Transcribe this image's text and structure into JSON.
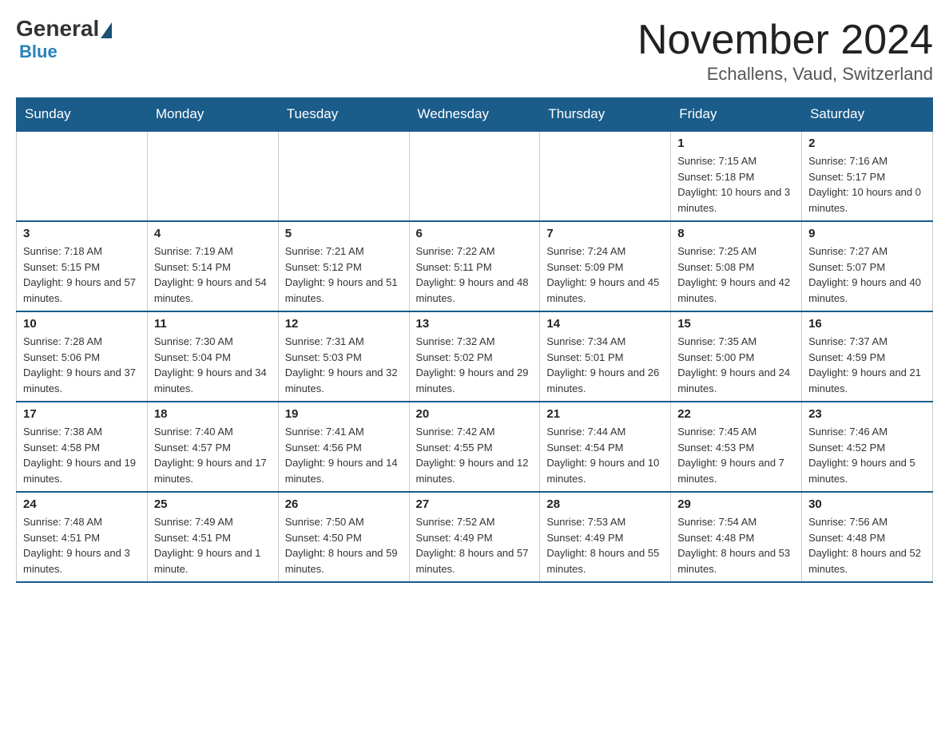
{
  "header": {
    "logo": {
      "general": "General",
      "blue": "Blue"
    },
    "title": "November 2024",
    "subtitle": "Echallens, Vaud, Switzerland"
  },
  "days_of_week": [
    "Sunday",
    "Monday",
    "Tuesday",
    "Wednesday",
    "Thursday",
    "Friday",
    "Saturday"
  ],
  "weeks": [
    [
      {
        "day": "",
        "empty": true
      },
      {
        "day": "",
        "empty": true
      },
      {
        "day": "",
        "empty": true
      },
      {
        "day": "",
        "empty": true
      },
      {
        "day": "",
        "empty": true
      },
      {
        "day": "1",
        "sunrise": "Sunrise: 7:15 AM",
        "sunset": "Sunset: 5:18 PM",
        "daylight": "Daylight: 10 hours and 3 minutes."
      },
      {
        "day": "2",
        "sunrise": "Sunrise: 7:16 AM",
        "sunset": "Sunset: 5:17 PM",
        "daylight": "Daylight: 10 hours and 0 minutes."
      }
    ],
    [
      {
        "day": "3",
        "sunrise": "Sunrise: 7:18 AM",
        "sunset": "Sunset: 5:15 PM",
        "daylight": "Daylight: 9 hours and 57 minutes."
      },
      {
        "day": "4",
        "sunrise": "Sunrise: 7:19 AM",
        "sunset": "Sunset: 5:14 PM",
        "daylight": "Daylight: 9 hours and 54 minutes."
      },
      {
        "day": "5",
        "sunrise": "Sunrise: 7:21 AM",
        "sunset": "Sunset: 5:12 PM",
        "daylight": "Daylight: 9 hours and 51 minutes."
      },
      {
        "day": "6",
        "sunrise": "Sunrise: 7:22 AM",
        "sunset": "Sunset: 5:11 PM",
        "daylight": "Daylight: 9 hours and 48 minutes."
      },
      {
        "day": "7",
        "sunrise": "Sunrise: 7:24 AM",
        "sunset": "Sunset: 5:09 PM",
        "daylight": "Daylight: 9 hours and 45 minutes."
      },
      {
        "day": "8",
        "sunrise": "Sunrise: 7:25 AM",
        "sunset": "Sunset: 5:08 PM",
        "daylight": "Daylight: 9 hours and 42 minutes."
      },
      {
        "day": "9",
        "sunrise": "Sunrise: 7:27 AM",
        "sunset": "Sunset: 5:07 PM",
        "daylight": "Daylight: 9 hours and 40 minutes."
      }
    ],
    [
      {
        "day": "10",
        "sunrise": "Sunrise: 7:28 AM",
        "sunset": "Sunset: 5:06 PM",
        "daylight": "Daylight: 9 hours and 37 minutes."
      },
      {
        "day": "11",
        "sunrise": "Sunrise: 7:30 AM",
        "sunset": "Sunset: 5:04 PM",
        "daylight": "Daylight: 9 hours and 34 minutes."
      },
      {
        "day": "12",
        "sunrise": "Sunrise: 7:31 AM",
        "sunset": "Sunset: 5:03 PM",
        "daylight": "Daylight: 9 hours and 32 minutes."
      },
      {
        "day": "13",
        "sunrise": "Sunrise: 7:32 AM",
        "sunset": "Sunset: 5:02 PM",
        "daylight": "Daylight: 9 hours and 29 minutes."
      },
      {
        "day": "14",
        "sunrise": "Sunrise: 7:34 AM",
        "sunset": "Sunset: 5:01 PM",
        "daylight": "Daylight: 9 hours and 26 minutes."
      },
      {
        "day": "15",
        "sunrise": "Sunrise: 7:35 AM",
        "sunset": "Sunset: 5:00 PM",
        "daylight": "Daylight: 9 hours and 24 minutes."
      },
      {
        "day": "16",
        "sunrise": "Sunrise: 7:37 AM",
        "sunset": "Sunset: 4:59 PM",
        "daylight": "Daylight: 9 hours and 21 minutes."
      }
    ],
    [
      {
        "day": "17",
        "sunrise": "Sunrise: 7:38 AM",
        "sunset": "Sunset: 4:58 PM",
        "daylight": "Daylight: 9 hours and 19 minutes."
      },
      {
        "day": "18",
        "sunrise": "Sunrise: 7:40 AM",
        "sunset": "Sunset: 4:57 PM",
        "daylight": "Daylight: 9 hours and 17 minutes."
      },
      {
        "day": "19",
        "sunrise": "Sunrise: 7:41 AM",
        "sunset": "Sunset: 4:56 PM",
        "daylight": "Daylight: 9 hours and 14 minutes."
      },
      {
        "day": "20",
        "sunrise": "Sunrise: 7:42 AM",
        "sunset": "Sunset: 4:55 PM",
        "daylight": "Daylight: 9 hours and 12 minutes."
      },
      {
        "day": "21",
        "sunrise": "Sunrise: 7:44 AM",
        "sunset": "Sunset: 4:54 PM",
        "daylight": "Daylight: 9 hours and 10 minutes."
      },
      {
        "day": "22",
        "sunrise": "Sunrise: 7:45 AM",
        "sunset": "Sunset: 4:53 PM",
        "daylight": "Daylight: 9 hours and 7 minutes."
      },
      {
        "day": "23",
        "sunrise": "Sunrise: 7:46 AM",
        "sunset": "Sunset: 4:52 PM",
        "daylight": "Daylight: 9 hours and 5 minutes."
      }
    ],
    [
      {
        "day": "24",
        "sunrise": "Sunrise: 7:48 AM",
        "sunset": "Sunset: 4:51 PM",
        "daylight": "Daylight: 9 hours and 3 minutes."
      },
      {
        "day": "25",
        "sunrise": "Sunrise: 7:49 AM",
        "sunset": "Sunset: 4:51 PM",
        "daylight": "Daylight: 9 hours and 1 minute."
      },
      {
        "day": "26",
        "sunrise": "Sunrise: 7:50 AM",
        "sunset": "Sunset: 4:50 PM",
        "daylight": "Daylight: 8 hours and 59 minutes."
      },
      {
        "day": "27",
        "sunrise": "Sunrise: 7:52 AM",
        "sunset": "Sunset: 4:49 PM",
        "daylight": "Daylight: 8 hours and 57 minutes."
      },
      {
        "day": "28",
        "sunrise": "Sunrise: 7:53 AM",
        "sunset": "Sunset: 4:49 PM",
        "daylight": "Daylight: 8 hours and 55 minutes."
      },
      {
        "day": "29",
        "sunrise": "Sunrise: 7:54 AM",
        "sunset": "Sunset: 4:48 PM",
        "daylight": "Daylight: 8 hours and 53 minutes."
      },
      {
        "day": "30",
        "sunrise": "Sunrise: 7:56 AM",
        "sunset": "Sunset: 4:48 PM",
        "daylight": "Daylight: 8 hours and 52 minutes."
      }
    ]
  ]
}
